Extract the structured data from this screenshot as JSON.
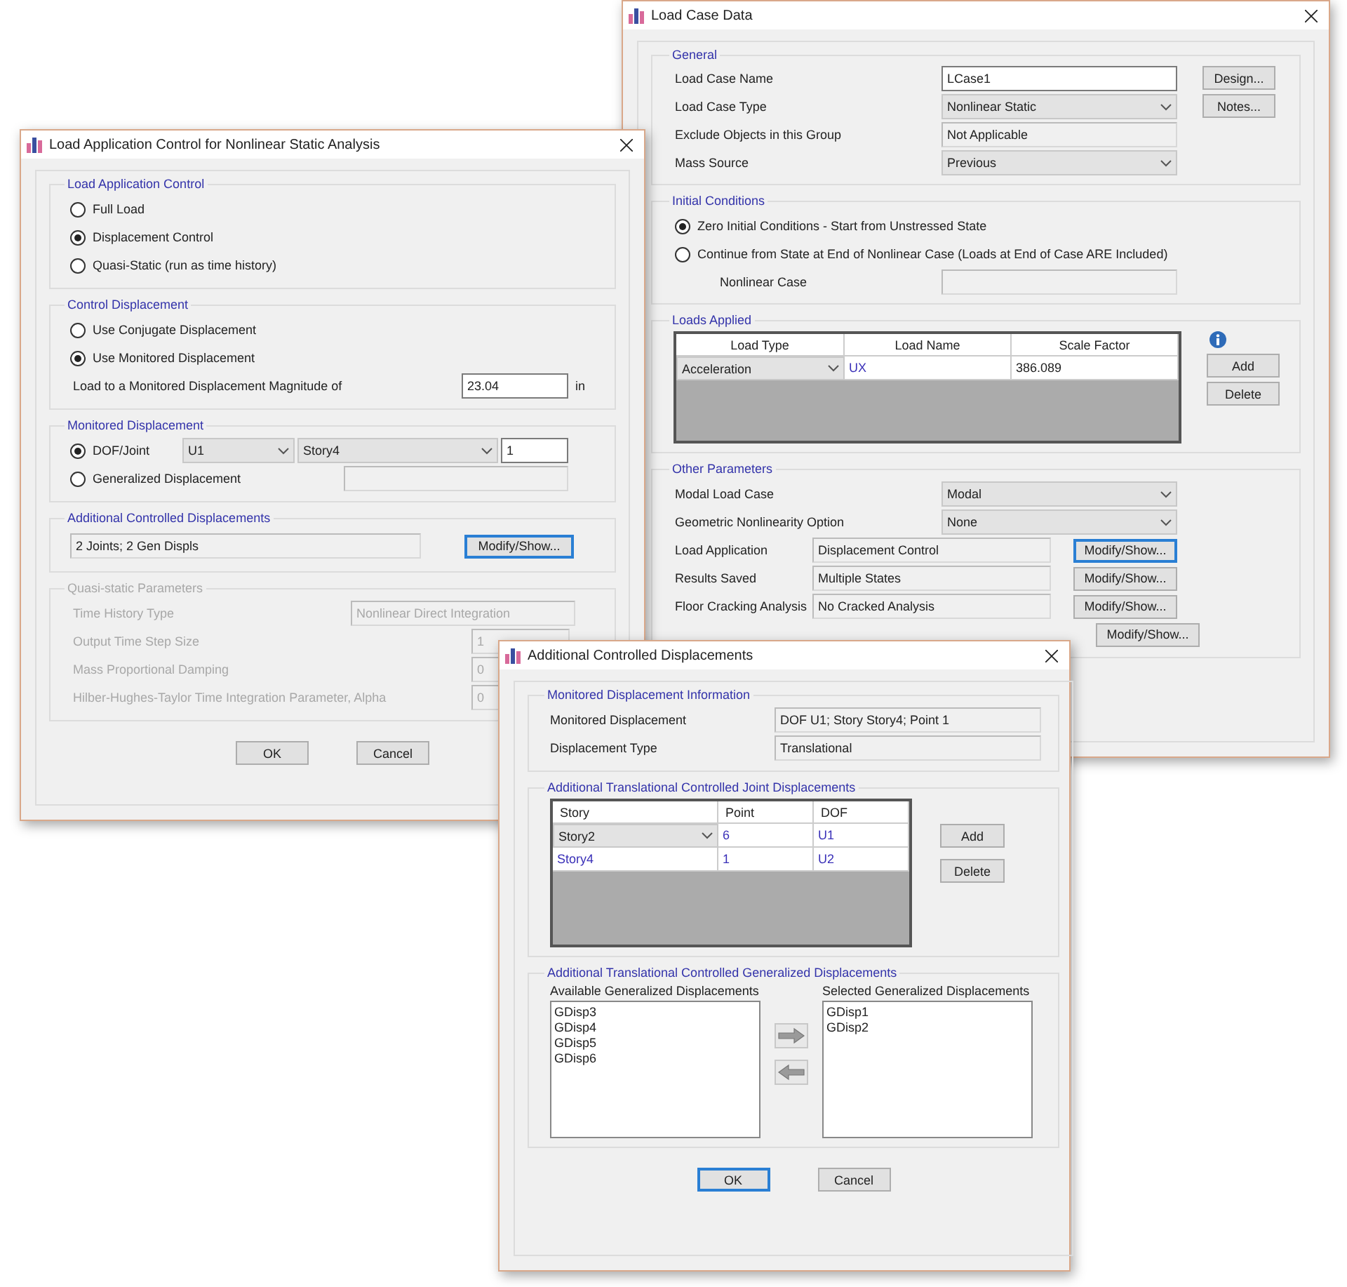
{
  "load_case_data": {
    "title": "Load Case Data",
    "general": {
      "legend": "General",
      "fields": [
        {
          "label": "Load Case Name",
          "value": "LCase1",
          "kind": "text"
        },
        {
          "label": "Load Case Type",
          "value": "Nonlinear Static",
          "kind": "dropdown"
        },
        {
          "label": "Exclude Objects in this Group",
          "value": "Not Applicable",
          "kind": "readonly"
        },
        {
          "label": "Mass Source",
          "value": "Previous",
          "kind": "dropdown"
        }
      ],
      "buttons": [
        {
          "label": "Design...",
          "focused": false
        },
        {
          "label": "Notes...",
          "focused": false
        }
      ]
    },
    "initial_conditions": {
      "legend": "Initial Conditions",
      "options": [
        {
          "label": "Zero Initial Conditions - Start from Unstressed State",
          "selected": true
        },
        {
          "label": "Continue from State at End of Nonlinear Case  (Loads at End of Case ARE Included)",
          "selected": false
        }
      ],
      "nonlinear_case": {
        "label": "Nonlinear Case"
      }
    },
    "loads_applied": {
      "legend": "Loads Applied",
      "columns": [
        "Load Type",
        "Load Name",
        "Scale Factor"
      ],
      "rows": [
        {
          "load_type": "Acceleration",
          "load_name": "UX",
          "scale_factor": "386.089",
          "editing": true
        }
      ],
      "buttons": [
        {
          "label": "Add",
          "focused": false
        },
        {
          "label": "Delete",
          "focused": false
        }
      ]
    },
    "other_parameters": {
      "legend": "Other Parameters",
      "rows": [
        {
          "label": "Modal Load Case",
          "value": "Modal",
          "kind": "dropdown"
        },
        {
          "label": "Geometric Nonlinearity Option",
          "value": "None",
          "kind": "dropdown"
        },
        {
          "label": "Load Application",
          "value": "Displacement Control",
          "kind": "readonly_button",
          "button": {
            "label": "Modify/Show...",
            "focused": true
          }
        },
        {
          "label": "Results Saved",
          "value": "Multiple States",
          "kind": "readonly_button",
          "button": {
            "label": "Modify/Show...",
            "focused": false
          }
        },
        {
          "label": "Floor Cracking Analysis",
          "value": "No Cracked Analysis",
          "kind": "readonly_button",
          "button": {
            "label": "Modify/Show...",
            "focused": false
          }
        },
        {
          "kind": "button_only",
          "button": {
            "label": "Modify/Show...",
            "focused": false
          }
        }
      ]
    }
  },
  "load_application_control": {
    "title": "Load Application Control for Nonlinear Static Analysis",
    "load_application_control": {
      "legend": "Load Application Control",
      "options": [
        {
          "label": "Full Load",
          "selected": false
        },
        {
          "label": "Displacement Control",
          "selected": true
        },
        {
          "label": "Quasi-Static (run as time history)",
          "selected": false
        }
      ]
    },
    "control_displacement": {
      "legend": "Control Displacement",
      "options": [
        {
          "label": "Use Conjugate Displacement",
          "selected": false
        },
        {
          "label": "Use Monitored Displacement",
          "selected": true
        }
      ],
      "magnitude": {
        "label": "Load to a Monitored Displacement Magnitude of",
        "value": "23.04",
        "unit": "in"
      }
    },
    "monitored_displacement": {
      "legend": "Monitored Displacement",
      "dof_joint": {
        "label": "DOF/Joint",
        "selected": true,
        "dof": "U1",
        "story": "Story4",
        "point": "1"
      },
      "generalized": {
        "label": "Generalized Displacement",
        "selected": false
      }
    },
    "additional_controlled": {
      "legend": "Additional Controlled Displacements",
      "value": "2 Joints; 2 Gen Displs",
      "button": {
        "label": "Modify/Show...",
        "focused": true
      }
    },
    "quasi_static": {
      "legend": "Quasi-static Parameters",
      "disabled": true,
      "rows": [
        {
          "label": "Time History Type",
          "value": "Nonlinear Direct Integration",
          "kind": "wide"
        },
        {
          "label": "Output Time Step Size",
          "value": "1",
          "kind": "narrow"
        },
        {
          "label": "Mass Proportional Damping",
          "value": "0",
          "kind": "narrow"
        },
        {
          "label": "Hilber-Hughes-Taylor Time Integration Parameter, Alpha",
          "value": "0",
          "kind": "narrow"
        }
      ]
    },
    "buttons": [
      {
        "label": "OK",
        "focused": false
      },
      {
        "label": "Cancel",
        "focused": false
      }
    ]
  },
  "additional_controlled_displacements": {
    "title": "Additional Controlled Displacements",
    "monitored_info": {
      "legend": "Monitored Displacement Information",
      "rows": [
        {
          "label": "Monitored Displacement",
          "value": "DOF U1; Story Story4; Point 1"
        },
        {
          "label": "Displacement Type",
          "value": "Translational"
        }
      ]
    },
    "joint_displacements": {
      "legend": "Additional Translational Controlled Joint Displacements",
      "columns": [
        "Story",
        "Point",
        "DOF"
      ],
      "rows": [
        {
          "story": "Story2",
          "point": "6",
          "dof": "U1",
          "editing": true
        },
        {
          "story": "Story4",
          "point": "1",
          "dof": "U2",
          "editing": false
        }
      ],
      "buttons": [
        {
          "label": "Add",
          "focused": false
        },
        {
          "label": "Delete",
          "focused": false
        }
      ]
    },
    "generalized_displacements": {
      "legend": "Additional Translational Controlled Generalized Displacements",
      "available": {
        "label": "Available Generalized Displacements",
        "items": [
          "GDisp3",
          "GDisp4",
          "GDisp5",
          "GDisp6"
        ]
      },
      "selected": {
        "label": "Selected Generalized Displacements",
        "items": [
          "GDisp1",
          "GDisp2"
        ]
      }
    },
    "buttons": [
      {
        "label": "OK",
        "focused": true
      },
      {
        "label": "Cancel",
        "focused": false
      }
    ]
  }
}
